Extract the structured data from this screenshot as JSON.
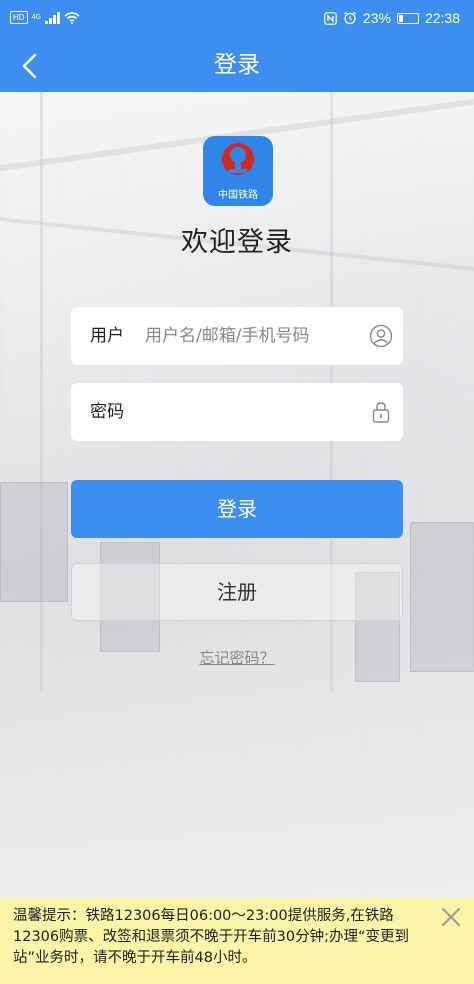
{
  "status_bar": {
    "hd": "HD",
    "network": "4G",
    "battery": "23%",
    "battery_level": 0.23,
    "time": "22:38",
    "icons": [
      "nfc-icon",
      "alarm-icon",
      "battery-icon",
      "wifi-icon",
      "signal-icon"
    ]
  },
  "header": {
    "title": "登录",
    "back_icon": "chevron-left-icon"
  },
  "logo": {
    "text": "中国铁路",
    "color": "#2f86e8"
  },
  "welcome": "欢迎登录",
  "form": {
    "username": {
      "label": "用户",
      "placeholder": "用户名/邮箱/手机号码",
      "value": "",
      "icon": "user-icon"
    },
    "password": {
      "label": "密码",
      "placeholder": "",
      "value": "",
      "icon": "lock-icon"
    }
  },
  "buttons": {
    "login": "登录",
    "register": "注册",
    "forgot": "忘记密码？"
  },
  "notice": {
    "text": "温馨提示：铁路12306每日06:00～23:00提供服务,在铁路12306购票、改签和退票须不晚于开车前30分钟;办理“变更到站”业务时，请不晚于开车前48小时。",
    "close_icon": "close-icon"
  },
  "colors": {
    "primary": "#3c8ff0",
    "notice_bg": "#fcf4a6"
  }
}
